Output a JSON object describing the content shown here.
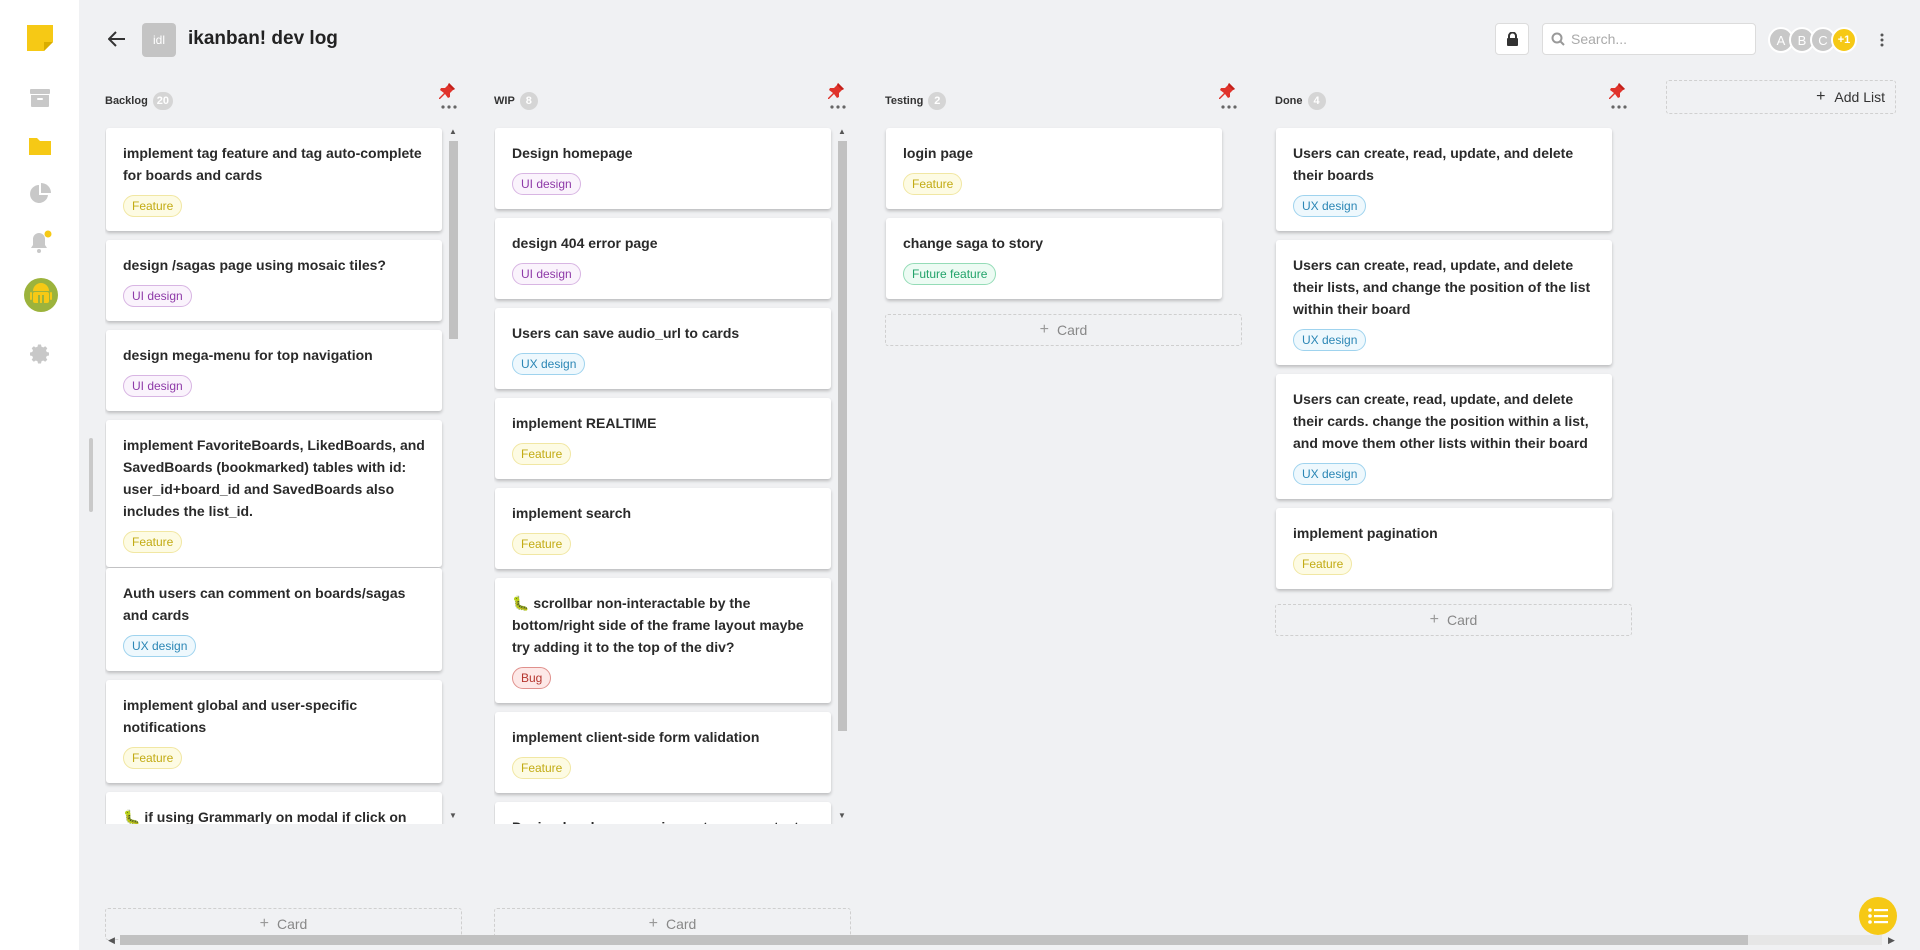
{
  "header": {
    "back_icon": "arrow-left-icon",
    "board_badge": "idl",
    "title": "ikanban! dev log",
    "search_placeholder": "Search...",
    "avatars": [
      "A",
      "B",
      "C"
    ],
    "avatars_more": "+1"
  },
  "rail": {
    "icons": [
      "sticky-note-logo",
      "archive-icon",
      "folder-icon",
      "pie-chart-icon",
      "bell-icon",
      "android-icon",
      "gear-icon"
    ],
    "accent_color": "#f6c915",
    "notification_dot": true
  },
  "lists": [
    {
      "name": "Backlog",
      "count": "20",
      "cards": [
        {
          "title": "implement tag feature and tag auto-complete for boards and cards",
          "tag": "Feature",
          "tag_type": "feature"
        },
        {
          "title": "design /sagas page using mosaic tiles?",
          "tag": "UI design",
          "tag_type": "ui"
        },
        {
          "title": "design mega-menu for top navigation",
          "tag": "UI design",
          "tag_type": "ui"
        },
        {
          "title": "implement FavoriteBoards, LikedBoards, and SavedBoards (bookmarked) tables with id: user_id+board_id and SavedBoards also includes the list_id.",
          "tag": "Feature",
          "tag_type": "feature"
        },
        {
          "title": "Auth users can comment on boards/sagas and cards",
          "tag": "UX design",
          "tag_type": "ux"
        },
        {
          "title": "implement global and user-specific notifications",
          "tag": "Feature",
          "tag_type": "feature"
        },
        {
          "title": "🐛 if using Grammarly on modal if click on",
          "tag": "",
          "tag_type": ""
        }
      ],
      "add_label": "Card"
    },
    {
      "name": "WIP",
      "count": "8",
      "cards": [
        {
          "title": "Design homepage",
          "tag": "UI design",
          "tag_type": "ui"
        },
        {
          "title": "design 404 error page",
          "tag": "UI design",
          "tag_type": "ui"
        },
        {
          "title": "Users can save audio_url to cards",
          "tag": "UX design",
          "tag_type": "ux"
        },
        {
          "title": "implement REALTIME",
          "tag": "Feature",
          "tag_type": "feature"
        },
        {
          "title": "implement search",
          "tag": "Feature",
          "tag_type": "feature"
        },
        {
          "title": "🐛 scrollbar non-interactable by the bottom/right side of the frame layout maybe try adding it to the top of the div?",
          "tag": "Bug",
          "tag_type": "bug"
        },
        {
          "title": "implement client-side form validation",
          "tag": "Feature",
          "tag_type": "feature"
        },
        {
          "title": "Design legal pages: privacy, terms, contact",
          "tag": "",
          "tag_type": ""
        }
      ],
      "add_label": "Card"
    },
    {
      "name": "Testing",
      "count": "2",
      "cards": [
        {
          "title": "login page",
          "tag": "Feature",
          "tag_type": "feature"
        },
        {
          "title": "change saga to story",
          "tag": "Future feature",
          "tag_type": "future"
        }
      ],
      "add_label": "Card"
    },
    {
      "name": "Done",
      "count": "4",
      "cards": [
        {
          "title": "Users can create, read, update, and delete their boards",
          "tag": "UX design",
          "tag_type": "ux"
        },
        {
          "title": "Users can create, read, update, and delete their lists, and change the position of the list within their board",
          "tag": "UX design",
          "tag_type": "ux"
        },
        {
          "title": "Users can create, read, update, and delete their cards. change the position within a list, and move them other lists within their board",
          "tag": "UX design",
          "tag_type": "ux"
        },
        {
          "title": "implement pagination",
          "tag": "Feature",
          "tag_type": "feature"
        }
      ],
      "add_label": "Card"
    }
  ],
  "add_list_label": "Add List",
  "tag_colors": {
    "feature": {
      "text": "#c2ab14",
      "bg": "#fdfbe3",
      "border": "#f1e7a3"
    },
    "ui": {
      "text": "#8e3aa8",
      "bg": "#faf3fc",
      "border": "#d8b5e3"
    },
    "ux": {
      "text": "#2b86b5",
      "bg": "#eef8fd",
      "border": "#9fd3ee"
    },
    "bug": {
      "text": "#b5362f",
      "bg": "#fde8e7",
      "border": "#e0908c"
    },
    "future": {
      "text": "#22a36a",
      "bg": "#ecfbf3",
      "border": "#94dcb7"
    }
  },
  "fab_icon": "list-icon"
}
